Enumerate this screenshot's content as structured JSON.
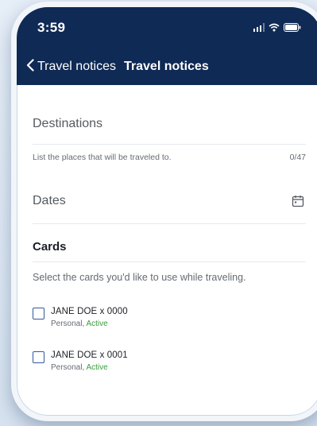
{
  "status_bar": {
    "time": "3:59"
  },
  "nav": {
    "back_label": "Travel notices",
    "title": "Travel notices"
  },
  "destinations": {
    "label": "Destinations",
    "hint": "List the places that will be traveled to.",
    "counter": "0/47"
  },
  "dates": {
    "label": "Dates",
    "icon": "calendar-icon"
  },
  "cards": {
    "title": "Cards",
    "description": "Select the cards you'd like to use while traveling.",
    "items": [
      {
        "name": "JANE DOE  x 0000",
        "type": "Personal,",
        "status": "Active"
      },
      {
        "name": "JANE DOE x 0001",
        "type": "Personal,",
        "status": "Active"
      }
    ]
  },
  "colors": {
    "header": "#0f2a55",
    "active_status": "#3c9b3c",
    "checkbox_border": "#2f5a9e"
  }
}
